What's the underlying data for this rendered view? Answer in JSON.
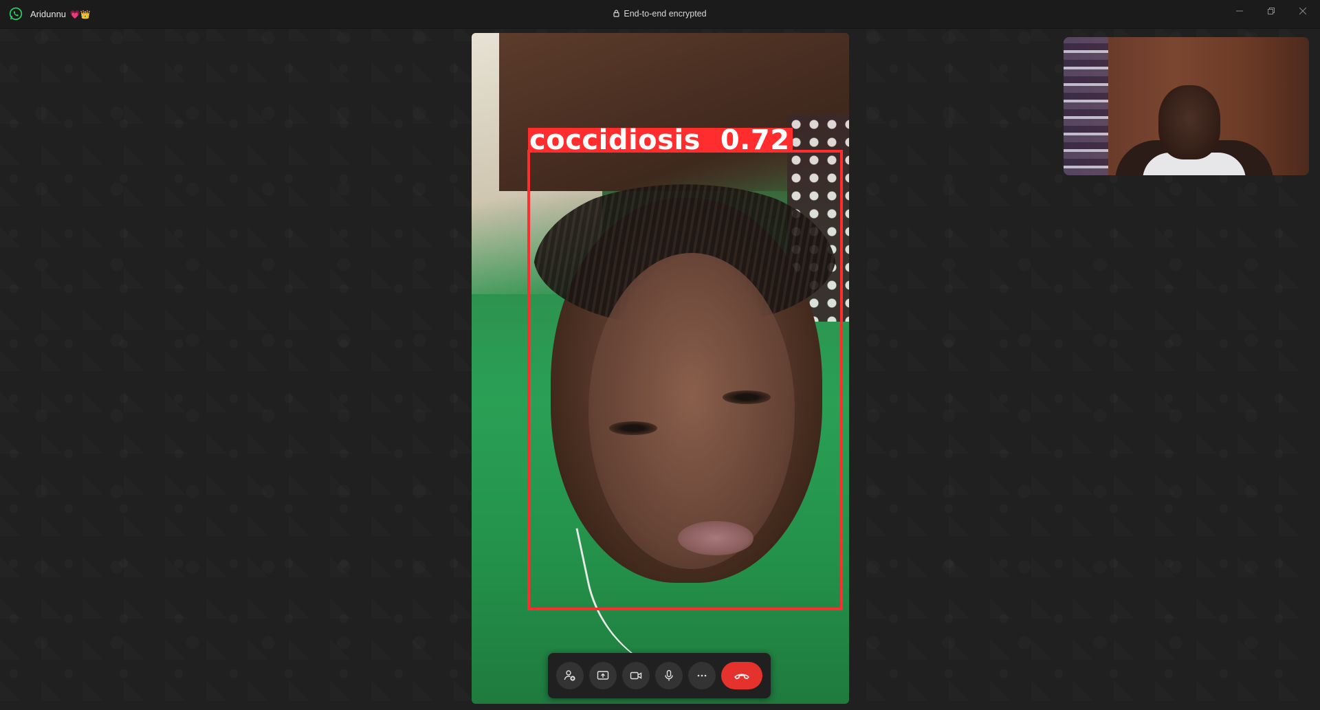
{
  "titlebar": {
    "contact_name": "Aridunnu",
    "contact_emoji": "💗👑",
    "encryption_text": "End-to-end encrypted"
  },
  "detection": {
    "label": "coccidiosis  0.72",
    "color": "#ff2d2d"
  },
  "controls": {
    "buttons": [
      "add-participant",
      "share-screen",
      "camera",
      "microphone",
      "more-options"
    ],
    "end_call_color": "#e5322d"
  },
  "colors": {
    "titlebar_bg": "#1b1b1b",
    "background": "#202020",
    "control_bar_bg": "#202020",
    "whatsapp_green": "#25d366"
  }
}
